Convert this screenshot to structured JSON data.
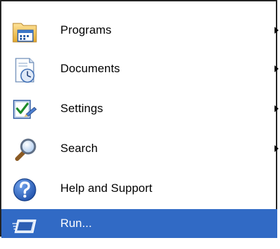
{
  "start_menu": {
    "items": [
      {
        "label": "Programs",
        "icon": "programs-folder-icon",
        "has_submenu": true
      },
      {
        "label": "Documents",
        "icon": "documents-icon",
        "has_submenu": true
      },
      {
        "label": "Settings",
        "icon": "settings-icon",
        "has_submenu": true
      },
      {
        "label": "Search",
        "icon": "search-icon",
        "has_submenu": true
      },
      {
        "label": "Help and Support",
        "icon": "help-icon",
        "has_submenu": false
      },
      {
        "label": "Run...",
        "icon": "run-icon",
        "has_submenu": false,
        "selected": true
      }
    ]
  },
  "colors": {
    "selected_bg": "#316ac5",
    "selected_text": "#ffffff",
    "border": "#222222"
  }
}
